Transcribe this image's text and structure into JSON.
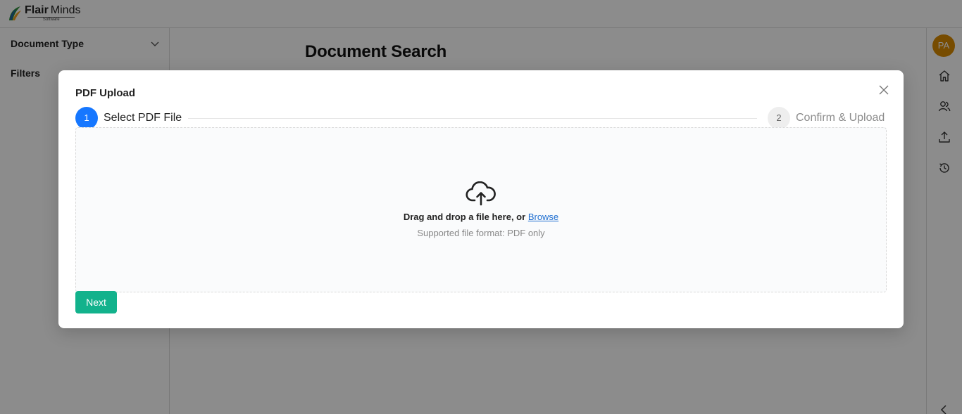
{
  "header": {
    "logo_brand_bold": "Flair",
    "logo_brand_light": "Minds",
    "logo_sub": "Software"
  },
  "sidebar": {
    "items": [
      {
        "label": "Document Type",
        "icon": "chevron-down-icon"
      },
      {
        "label": "Filters",
        "icon": "chevron-down-icon"
      }
    ]
  },
  "main": {
    "title": "Document Search"
  },
  "rail": {
    "avatar_initials": "PA",
    "avatar_color": "#d98a00",
    "icons": [
      "home-icon",
      "users-icon",
      "upload-icon",
      "history-icon",
      "chevron-left-icon"
    ]
  },
  "modal": {
    "title": "PDF Upload",
    "steps": [
      {
        "number": "1",
        "label": "Select PDF File",
        "state": "active"
      },
      {
        "number": "2",
        "label": "Confirm & Upload",
        "state": "pending"
      }
    ],
    "dropzone": {
      "icon": "cloud-upload-icon",
      "text": "Drag and drop a file here, or",
      "browse_label": "Browse",
      "hint": "Supported file format: PDF only"
    },
    "next_label": "Next",
    "colors": {
      "step_active": "#1677ff",
      "next_button": "#12b28c",
      "link": "#1f6fd1"
    }
  }
}
